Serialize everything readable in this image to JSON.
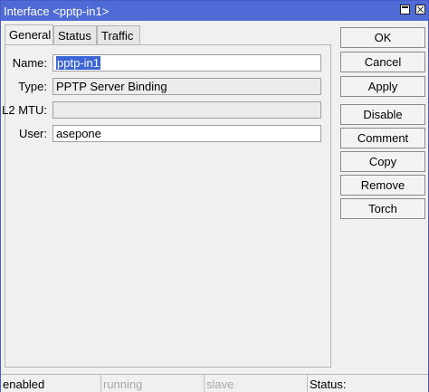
{
  "window": {
    "title": "Interface <pptp-in1>"
  },
  "tabs": [
    {
      "label": "General"
    },
    {
      "label": "Status"
    },
    {
      "label": "Traffic"
    }
  ],
  "form": {
    "name_label": "Name:",
    "name_value": "pptp-in1",
    "type_label": "Type:",
    "type_value": "PPTP Server Binding",
    "mtu_label": "L2 MTU:",
    "mtu_value": "",
    "user_label": "User:",
    "user_value": "asepone"
  },
  "buttons": {
    "ok": "OK",
    "cancel": "Cancel",
    "apply": "Apply",
    "disable": "Disable",
    "comment": "Comment",
    "copy": "Copy",
    "remove": "Remove",
    "torch": "Torch"
  },
  "statusbar": {
    "enabled": "enabled",
    "running": "running",
    "slave": "slave",
    "status": "Status:"
  }
}
